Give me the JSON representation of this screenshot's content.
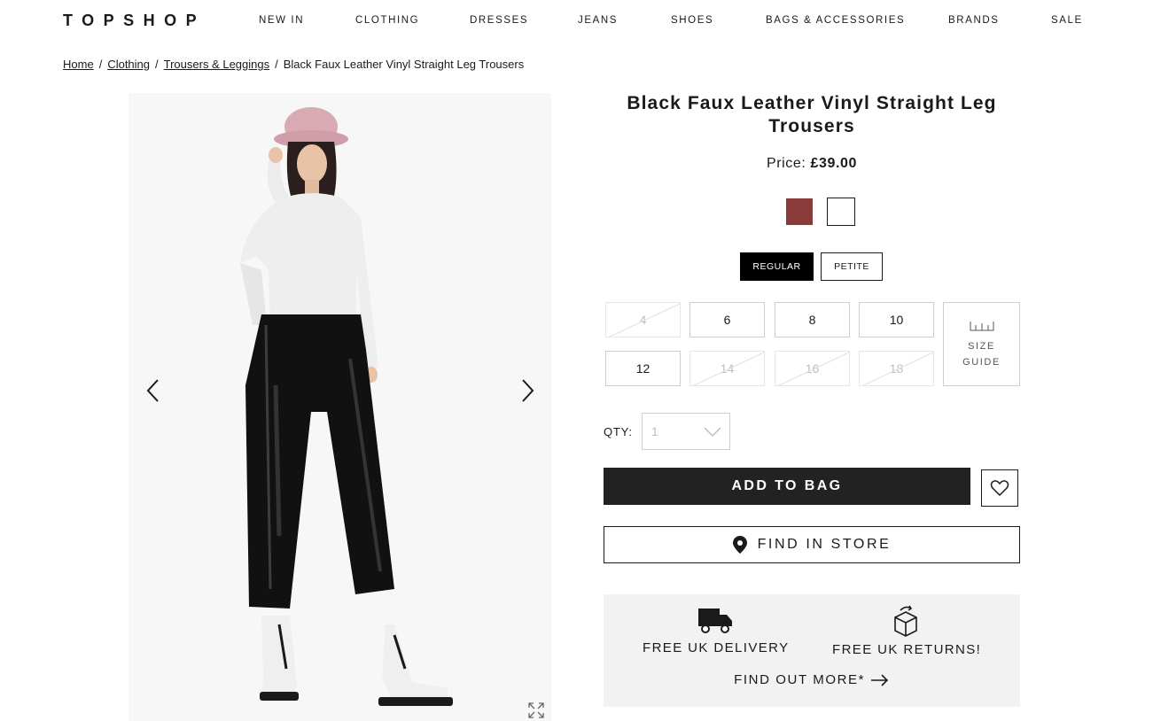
{
  "header": {
    "logo": "TOPSHOP",
    "nav": [
      "NEW IN",
      "CLOTHING",
      "DRESSES",
      "JEANS",
      "SHOES",
      "BAGS & ACCESSORIES",
      "BRANDS",
      "SALE"
    ]
  },
  "breadcrumb": {
    "items": [
      "Home",
      "Clothing",
      "Trousers & Leggings"
    ],
    "current": "Black Faux Leather Vinyl Straight Leg Trousers"
  },
  "product": {
    "title": "Black Faux Leather Vinyl Straight Leg Trousers",
    "price_label": "Price:",
    "price": "£39.00",
    "swatches": [
      {
        "name": "red",
        "color": "#8b3a3a"
      },
      {
        "name": "white",
        "color": "#ffffff"
      }
    ],
    "fits": [
      "REGULAR",
      "PETITE"
    ],
    "selected_fit": "REGULAR",
    "sizes": [
      {
        "label": "4",
        "available": false
      },
      {
        "label": "6",
        "available": true
      },
      {
        "label": "8",
        "available": true
      },
      {
        "label": "10",
        "available": true
      },
      {
        "label": "12",
        "available": true
      },
      {
        "label": "14",
        "available": false
      },
      {
        "label": "16",
        "available": false
      },
      {
        "label": "18",
        "available": false
      }
    ],
    "size_guide": {
      "line1": "SIZE",
      "line2": "GUIDE"
    },
    "qty_label": "QTY:",
    "qty_value": "1",
    "add_to_bag": "ADD TO BAG",
    "find_in_store": "FIND IN STORE"
  },
  "promo": {
    "delivery": "FREE UK DELIVERY",
    "returns": "FREE UK RETURNS!",
    "find_out_more": "FIND OUT MORE*"
  },
  "icons": {
    "prev": "chevron-left-icon",
    "next": "chevron-right-icon",
    "expand": "expand-icon",
    "wishlist": "heart-icon",
    "store": "location-pin-icon",
    "delivery": "truck-icon",
    "returns": "return-box-icon",
    "more": "arrow-right-icon",
    "qty": "chevron-down-icon",
    "size_guide": "ruler-icon"
  },
  "colors": {
    "button_dark": "#222222",
    "promo_bg": "#f2f2f2",
    "image_bg": "#f7f7f7",
    "swatch_red": "#8b3a3a"
  }
}
